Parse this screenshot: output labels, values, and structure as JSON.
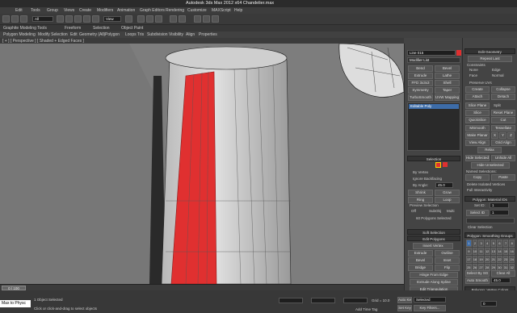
{
  "title": "Autodesk 3ds Max 2012 x64   Chandelier.max",
  "menu": [
    "Edit",
    "Tools",
    "Group",
    "Views",
    "Create",
    "Modifiers",
    "Animation",
    "Graph Editors",
    "Rendering",
    "Customize",
    "MAXScript",
    "Help"
  ],
  "ribbon_title": "Graphite Modeling Tools",
  "ribbon_tabs": [
    "Freeform",
    "Selection",
    "Object Paint"
  ],
  "ribbon2": [
    "Polygon Modeling",
    "Modify Selection",
    "Edit",
    "Geometry (All)",
    "Polygon",
    "Loops",
    "Tris",
    "Subdivision",
    "Visibility",
    "Align",
    "Properties"
  ],
  "toolbar": {
    "filter": "All",
    "view": "View"
  },
  "viewport_label": "[ + ] [ Perspective ] [ Shaded + Edged Faces ]",
  "cmd": {
    "name": "Line 015",
    "modlist": "Modifier List",
    "buttons": [
      "Bend",
      "Bevel",
      "Extrude",
      "Lathe",
      "FFD 3x3x3",
      "Shell",
      "Symmetry",
      "Taper",
      "TurboSmooth",
      "UVW Mapping CII"
    ],
    "stack_item": "Editable Poly",
    "selection": "Selection",
    "by_vertex": "By Vertex",
    "ignore_backfacing": "Ignore Backfacing",
    "by_angle": "By Angle:",
    "angle": "45.0",
    "shrink": "Shrink",
    "grow": "Grow",
    "ring": "Ring",
    "loop": "Loop",
    "preview": "Preview Selection",
    "off": "Off",
    "subobj": "SubObj",
    "multi": "Multi",
    "status": "60 Polygons Selected",
    "soft": "Soft Selection",
    "edit_poly": "Edit Polygons",
    "insert_vertex": "Insert Vertex",
    "extrude": "Extrude",
    "outline": "Outline",
    "bevel": "Bevel",
    "inset": "Inset",
    "bridge": "Bridge",
    "flip": "Flip",
    "hinge": "Hinge From Edge",
    "extrude_spline": "Extrude Along Spline",
    "edit_tri": "Edit Triangulation",
    "retriangulate": "Retriangulate",
    "turn": "Turn"
  },
  "right": {
    "edit_geom": "Edit Geometry",
    "repeat_last": "Repeat Last",
    "constraints": "Constraints",
    "none": "None",
    "edge": "Edge",
    "face": "Face",
    "normal": "Normal",
    "preserve": "Preserve UVs",
    "create": "Create",
    "collapse": "Collapse",
    "attach": "Attach",
    "detach": "Detach",
    "slice_plane": "Slice Plane",
    "split": "Split",
    "slice": "Slice",
    "reset_plane": "Reset Plane",
    "quickslice": "QuickSlice",
    "cut": "Cut",
    "msmooth": "MSmooth",
    "tessellate": "Tessellate",
    "make_planar": "Make Planar",
    "x": "X",
    "y": "Y",
    "z": "Z",
    "view_align": "View Align",
    "grid_align": "Grid Align",
    "relax": "Relax",
    "hide_sel": "Hide Selected",
    "unhide_all": "Unhide All",
    "hide_unsel": "Hide Unselected",
    "named_sel": "Named Selections:",
    "copy": "Copy",
    "paste": "Paste",
    "delete_iso": "Delete Isolated Vertices",
    "full_inter": "Full Interactivity",
    "mat_ids": "Polygon: Material IDs",
    "set_id": "Set ID:",
    "select_id": "Select ID",
    "id_val": "1",
    "clear_sel": "Clear Selection",
    "smooth_groups": "Polygon: Smoothing Groups",
    "select_by_sg": "Select By SG",
    "clear_all": "Clear All",
    "auto_smooth": "Auto Smooth",
    "as_val": "45.0",
    "vertex_colors": "Polygon: Vertex Colors",
    "sg": [
      "1",
      "2",
      "3",
      "4",
      "5",
      "6",
      "7",
      "8",
      "9",
      "10",
      "11",
      "12",
      "13",
      "14",
      "15",
      "16",
      "17",
      "18",
      "19",
      "20",
      "21",
      "22",
      "23",
      "24",
      "25",
      "26",
      "27",
      "28",
      "29",
      "30",
      "31",
      "32"
    ]
  },
  "timeline": "0 / 100",
  "status": {
    "maxscript": "Max to Physc",
    "objects": "1 Object Selected",
    "prompt": "Click or click-and-drag to select objects",
    "x": "",
    "y": "",
    "z": "",
    "grid": "Grid = 10.0",
    "autokey": "Auto Key",
    "selected": "Selected",
    "setkey": "Set Key",
    "keyfilters": "Key Filters...",
    "addtime": "Add Time Tag",
    "frame": "0"
  },
  "colors": {
    "accent": "#e03030",
    "selection": "#ffd400"
  }
}
